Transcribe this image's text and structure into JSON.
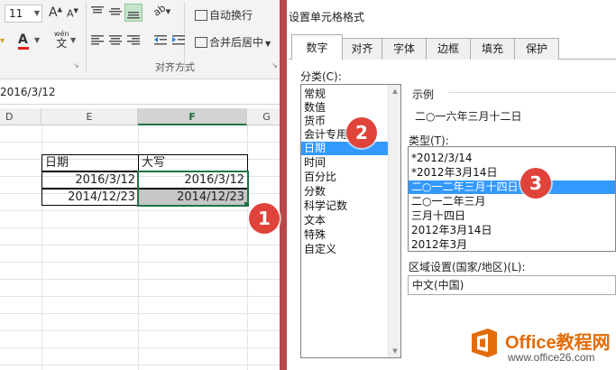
{
  "ribbon": {
    "font_size": "11",
    "grow_font": "A",
    "shrink_font": "A",
    "phonetic_label": "wén",
    "phonetic_glyph": "文",
    "font_color_glyph": "A",
    "wrap_text": "自动换行",
    "merge_center": "合并后居中",
    "alignment_group": "对齐方式",
    "orientation_glyph": "ab"
  },
  "formula_bar": {
    "value": "2016/3/12"
  },
  "sheet": {
    "columns": [
      "D",
      "E",
      "F",
      "G"
    ],
    "selected_column": "F",
    "headers": [
      "日期",
      "大写"
    ],
    "rows": [
      [
        "2016/3/12",
        "2016/3/12"
      ],
      [
        "2014/12/23",
        "2014/12/23"
      ]
    ]
  },
  "dialog": {
    "title": "设置单元格格式",
    "tabs": [
      "数字",
      "对齐",
      "字体",
      "边框",
      "填充",
      "保护"
    ],
    "active_tab": "数字",
    "category_label": "分类(C):",
    "categories": [
      "常规",
      "数值",
      "货币",
      "会计专用",
      "日期",
      "时间",
      "百分比",
      "分数",
      "科学记数",
      "文本",
      "特殊",
      "自定义"
    ],
    "selected_category": "日期",
    "sample_label": "示例",
    "sample_value": "二○一六年三月十二日",
    "type_label": "类型(T):",
    "types": [
      "*2012/3/14",
      "*2012年3月14日",
      "二○一二年三月十四日",
      "二○一二年三月",
      "三月十四日",
      "2012年3月14日",
      "2012年3月"
    ],
    "selected_type": "二○一二年三月十四日",
    "locale_label": "区域设置(国家/地区)(L):",
    "locale_value": "中文(中国)"
  },
  "callouts": [
    "1",
    "2",
    "3"
  ],
  "watermark": {
    "brand": "Office教程网",
    "url": "www.office26.com"
  },
  "colors": {
    "excel_green": "#217346",
    "selection_blue": "#3399ff",
    "callout_red": "#e0433a",
    "dialog_accent": "#b8484a",
    "brand_orange": "#e36c09"
  }
}
